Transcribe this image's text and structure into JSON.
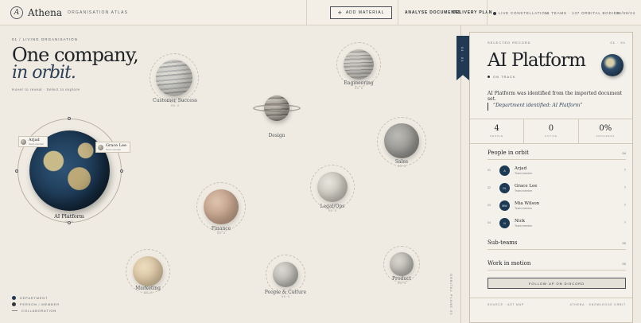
{
  "header": {
    "logo_letter": "A",
    "brand": "Athena",
    "brand_sub": "ORGANISATION ATLAS",
    "add_button": "ADD MATERIAL",
    "nav": [
      "ANALYSE DOCUMENTS",
      "DELIVERY PLAN"
    ],
    "live": "LIVE CONSTELLATION",
    "teams": "11 TEAMS · 137 ORBITAL BODIES",
    "date": "06/08/24"
  },
  "map": {
    "eyebrow": "01 / LIVING ORGANISATION",
    "title_line1": "One company,",
    "title_line2": "in orbit.",
    "hint": "Hover to reveal · Select to explore",
    "departments": [
      {
        "label": "Customer Success",
        "sub": "0·0 · 0"
      },
      {
        "label": "Engineering",
        "sub": "0·0 · 0"
      },
      {
        "label": "Design",
        "sub": "0·0 · 0"
      },
      {
        "label": "Sales",
        "sub": "0·0 · 0"
      },
      {
        "label": "Legal/Ops",
        "sub": "0·0 · 0"
      },
      {
        "label": "Finance",
        "sub": "0·0 · 0"
      },
      {
        "label": "Marketing",
        "sub": "0·0 · 0"
      },
      {
        "label": "People & Culture",
        "sub": "0·0 · 0"
      },
      {
        "label": "Product",
        "sub": "0·0 · 0"
      }
    ],
    "focus": {
      "label": "AI Platform",
      "sub": "04 · 01"
    },
    "chips": [
      {
        "name": "Arjad",
        "role": "Team member"
      },
      {
        "name": "Grace Lee",
        "role": "Team member"
      }
    ],
    "legend": [
      {
        "label": "DEPARTMENT"
      },
      {
        "label": "PERSON / MEMBER"
      },
      {
        "label": "COLLABORATION"
      }
    ],
    "tab_text": "01 · 01",
    "vertical_text": "ORBITAL PLANE 02"
  },
  "panel": {
    "eyebrow": "SELECTED RECORD",
    "count": "01 · 01",
    "title": "AI Platform",
    "track": "ON TRACK",
    "description": "AI Platform was identified from the imported document set.",
    "quote": "“Department identified: AI Platform”",
    "stats": [
      {
        "value": "4",
        "label": "PEOPLE"
      },
      {
        "value": "0",
        "label": "ACTIVE"
      },
      {
        "value": "0%",
        "label": "PROGRESS"
      }
    ],
    "people_heading": "People in orbit",
    "people_count": "04",
    "people": [
      {
        "idx": "01",
        "initials": "A",
        "name": "Arjad",
        "role": "Team member"
      },
      {
        "idx": "02",
        "initials": "GL",
        "name": "Grace Lee",
        "role": "Team member"
      },
      {
        "idx": "03",
        "initials": "MW",
        "name": "Mia Wilson",
        "role": "Team member"
      },
      {
        "idx": "04",
        "initials": "N",
        "name": "Nick",
        "role": "Team member"
      }
    ],
    "subteams_heading": "Sub-teams",
    "subteams_count": "00",
    "work_heading": "Work in motion",
    "work_count": "00",
    "follow_button": "FOLLOW UP ON DISCORD",
    "footer_left": "SOURCE · AST MAP",
    "footer_right": "ATHENA · KNOWLEDGE ORBIT"
  },
  "colors": {
    "accent": "#1f3a52",
    "background": "#efebe2",
    "panel": "#f4f1ea"
  },
  "icons": [
    "logo-mark-icon",
    "plus-icon",
    "live-dot-icon",
    "chevron-right-icon"
  ]
}
